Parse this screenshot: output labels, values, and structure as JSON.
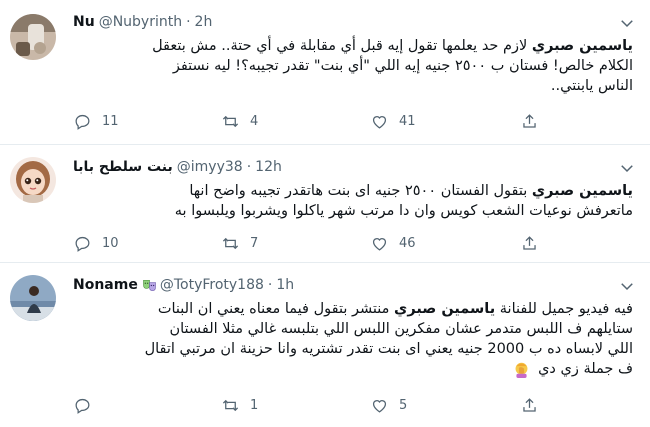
{
  "tweets": [
    {
      "name": "Nu",
      "handle": "@Nubyrinth",
      "dot": "·",
      "time": "2h",
      "mention": "ياسمين صبري",
      "lines": [
        "لازم حد يعلمها تقول إيه قبل أي مقابلة في أي حتة.. مش بتعقل",
        "الكلام خالص! فستان ب ٢٥٠٠ جنيه إيه اللي \"أي بنت\" تقدر تجيبه؟! ليه نستفز",
        "الناس يابنتي.."
      ],
      "replies": "11",
      "retweets": "4",
      "likes": "41"
    },
    {
      "name": "بنت سلطح بابا",
      "handle": "@imyy38",
      "dot": "·",
      "time": "12h",
      "mention": "ياسمين صبري",
      "lines": [
        "بتقول الفستان ٢٥٠٠ جنيه اى بنت هاتقدر تجيبه واضح انها",
        "ماتعرفش نوعيات الشعب كويس وان دا مرتب شهر ياكلوا ويشربوا ويلبسوا به"
      ],
      "replies": "10",
      "retweets": "7",
      "likes": "46"
    },
    {
      "name": "Noname",
      "handle": "@TotyFroty188",
      "dot": "·",
      "time": "1h",
      "mention": "ياسمين صبري",
      "lead": "فيه فيديو جميل للفنانة",
      "lines": [
        "منتشر بتقول فيما معناه يعني ان البنات",
        "ستايلهم ف اللبس متدمر عشان مفكرين اللبس اللي بتلبسه غالي مثلا الفستان",
        "اللي لابساه ده ب 2000 جنيه يعني اى بنت تقدر تشتريه وانا حزينة ان مرتبي اتقال",
        "ف جملة زي دي"
      ],
      "replies": "",
      "retweets": "1",
      "likes": "5"
    }
  ],
  "icons": {
    "reply": "reply-icon",
    "retweet": "retweet-icon",
    "like": "heart-icon",
    "share": "share-icon",
    "more": "chevron-down-icon"
  },
  "colors": {
    "text": "#0f1419",
    "secondary": "#536471",
    "divider": "#e6ecf0"
  }
}
